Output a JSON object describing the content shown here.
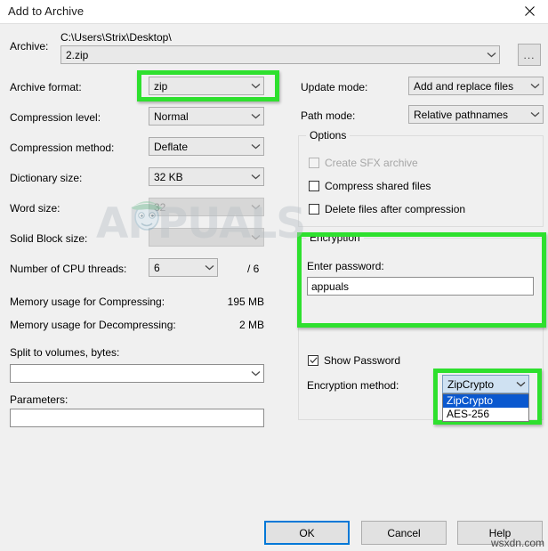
{
  "window": {
    "title": "Add to Archive",
    "close_icon": "close-icon"
  },
  "archive": {
    "label": "Archive:",
    "path_text": "C:\\Users\\Strix\\Desktop\\",
    "filename_value": "2.zip",
    "browse_label": "..."
  },
  "left_column": {
    "archive_format": {
      "label": "Archive format:",
      "value": "zip"
    },
    "compression_level": {
      "label": "Compression level:",
      "value": "Normal"
    },
    "compression_method": {
      "label": "Compression method:",
      "value": "Deflate"
    },
    "dictionary_size": {
      "label": "Dictionary size:",
      "value": "32 KB"
    },
    "word_size": {
      "label": "Word size:",
      "value": "32",
      "disabled": true
    },
    "solid_block_size": {
      "label": "Solid Block size:",
      "value": "",
      "disabled": true
    },
    "cpu_threads": {
      "label": "Number of CPU threads:",
      "value": "6",
      "total": "/ 6"
    },
    "memory_compress": {
      "label": "Memory usage for Compressing:",
      "value": "195 MB"
    },
    "memory_decompress": {
      "label": "Memory usage for Decompressing:",
      "value": "2 MB"
    },
    "split_volumes": {
      "label": "Split to volumes, bytes:",
      "value": ""
    },
    "parameters": {
      "label": "Parameters:",
      "value": ""
    }
  },
  "right_column": {
    "update_mode": {
      "label": "Update mode:",
      "value": "Add and replace files"
    },
    "path_mode": {
      "label": "Path mode:",
      "value": "Relative pathnames"
    },
    "options": {
      "title": "Options",
      "items": [
        {
          "label": "Create SFX archive",
          "checked": false,
          "disabled": true
        },
        {
          "label": "Compress shared files",
          "checked": false,
          "disabled": false
        },
        {
          "label": "Delete files after compression",
          "checked": false,
          "disabled": false
        }
      ]
    },
    "encryption": {
      "title": "Encryption",
      "password_label": "Enter password:",
      "password_value": "appuals",
      "show_password_label": "Show Password",
      "show_password_checked": true,
      "method_label": "Encryption method:",
      "method_value": "ZipCrypto",
      "method_options": [
        "ZipCrypto",
        "AES-256"
      ],
      "method_selected_index": 0
    }
  },
  "buttons": {
    "ok": "OK",
    "cancel": "Cancel",
    "help": "Help"
  },
  "watermarks": {
    "logo_text": "APPUALS",
    "site": "wsxdn.com"
  },
  "colors": {
    "dialog_bg": "#f0f0f0",
    "highlight_green": "#2ee02e",
    "accent_blue": "#0078d7",
    "list_selection": "#0a58cf"
  }
}
